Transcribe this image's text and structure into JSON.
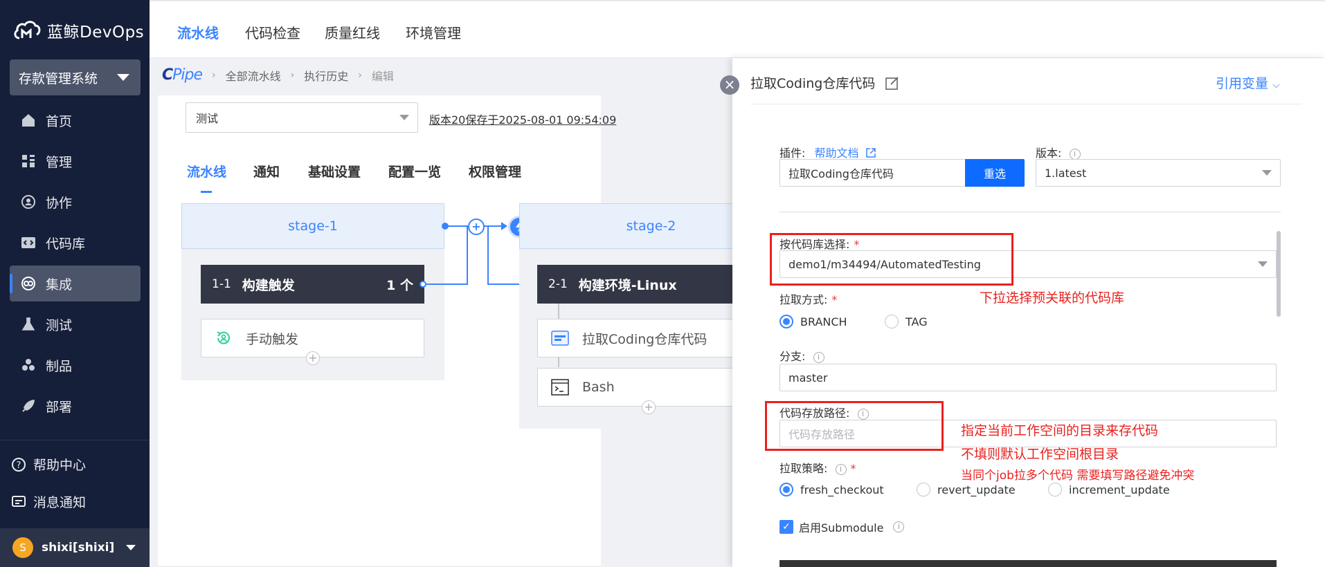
{
  "sidebar": {
    "logo_text": "蓝鲸DevOps",
    "project": "存款管理系统",
    "items": [
      {
        "label": "首页",
        "icon": "home-icon"
      },
      {
        "label": "管理",
        "icon": "grid-icon"
      },
      {
        "label": "协作",
        "icon": "collab-icon"
      },
      {
        "label": "代码库",
        "icon": "code-icon"
      },
      {
        "label": "集成",
        "icon": "integration-icon"
      },
      {
        "label": "测试",
        "icon": "test-icon"
      },
      {
        "label": "制品",
        "icon": "artifact-icon"
      },
      {
        "label": "部署",
        "icon": "rocket-icon"
      }
    ],
    "help": "帮助中心",
    "messages": "消息通知",
    "user": "shixi[shixi]",
    "avatar_letter": "S"
  },
  "topnav": {
    "tabs": [
      "流水线",
      "代码检查",
      "质量红线",
      "环境管理"
    ]
  },
  "breadcrumb": {
    "logo_main": "C",
    "logo_rest": "Pipe",
    "items": [
      "全部流水线",
      "执行历史",
      "编辑"
    ]
  },
  "editor": {
    "version_select": "测试",
    "version_info": "版本20保存于2025-08-01 09:54:09",
    "tabs": [
      "流水线",
      "通知",
      "基础设置",
      "配置一览",
      "权限管理"
    ]
  },
  "pipeline": {
    "stage1": {
      "name": "stage-1",
      "job_num": "1-1",
      "job_title": "构建触发",
      "job_count": "1 个",
      "atom": "手动触发"
    },
    "stage2": {
      "name": "stage-2",
      "job_num": "2-1",
      "job_title": "构建环境-Linux",
      "atoms": [
        "拉取Coding仓库代码",
        "Bash"
      ]
    }
  },
  "panel": {
    "title": "拉取Coding仓库代码",
    "ref_var": "引用变量",
    "plugin_label": "插件:",
    "help_doc": "帮助文档",
    "plugin_value": "拉取Coding仓库代码",
    "reselect": "重选",
    "version_label": "版本:",
    "version_value": "1.latest",
    "repo_label": "按代码库选择:",
    "repo_value": "demo1/m34494/AutomatedTesting",
    "pull_mode_label": "拉取方式:",
    "pull_modes": [
      "BRANCH",
      "TAG"
    ],
    "branch_label": "分支:",
    "branch_value": "master",
    "path_label": "代码存放路径:",
    "path_placeholder": "代码存放路径",
    "strategy_label": "拉取策略:",
    "strategies": [
      "fresh_checkout",
      "revert_update",
      "increment_update"
    ],
    "submodule": "启用Submodule",
    "annotations": {
      "repo_hint": "下拉选择预关联的代码库",
      "path_hint1": "指定当前工作空间的目录来存代码",
      "path_hint2": "不填则默认工作空间根目录",
      "path_hint3": "当同个job拉多个代码 需要填写路径避免冲突"
    }
  },
  "colors": {
    "accent": "#3a84ff",
    "sidebar_bg": "#161f39",
    "annotation_red": "#e8211e"
  }
}
